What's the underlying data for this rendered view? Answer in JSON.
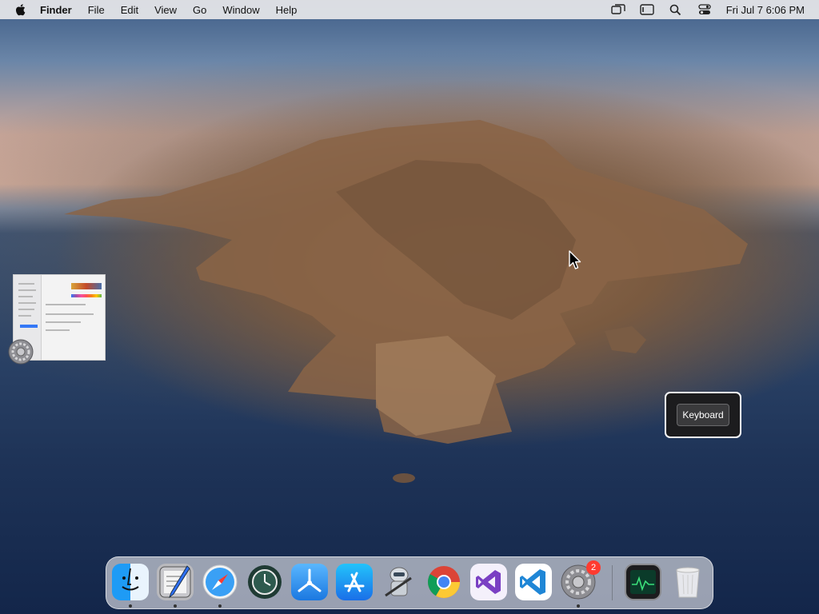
{
  "menubar": {
    "apple_icon": "apple-logo-icon",
    "app_name": "Finder",
    "menus": [
      "File",
      "Edit",
      "View",
      "Go",
      "Window",
      "Help"
    ],
    "status_icons": [
      "screen-mirroring-icon",
      "display-icon",
      "spotlight-search-icon",
      "control-center-icon"
    ],
    "clock": "Fri Jul 7  6:06 PM"
  },
  "desktop": {
    "wallpaper": "macOS Catalina island wallpaper",
    "window_thumbnail": {
      "app_icon": "system-preferences-icon"
    },
    "popup": {
      "button_label": "Keyboard"
    }
  },
  "dock": {
    "apps": [
      {
        "name": "Finder",
        "icon": "finder-icon",
        "running": true
      },
      {
        "name": "Script Editor",
        "icon": "script-editor-icon",
        "running": true
      },
      {
        "name": "Safari",
        "icon": "safari-icon",
        "running": true
      },
      {
        "name": "Time Machine",
        "icon": "time-machine-icon",
        "running": false
      },
      {
        "name": "Instruments",
        "icon": "instruments-icon",
        "running": false
      },
      {
        "name": "App Store",
        "icon": "app-store-icon",
        "running": false
      },
      {
        "name": "Automator",
        "icon": "automator-icon",
        "running": false
      },
      {
        "name": "Google Chrome",
        "icon": "chrome-icon",
        "running": false
      },
      {
        "name": "Visual Studio",
        "icon": "visual-studio-icon",
        "running": false
      },
      {
        "name": "Visual Studio Code",
        "icon": "vscode-icon",
        "running": false
      },
      {
        "name": "System Preferences",
        "icon": "system-preferences-icon",
        "running": true,
        "badge": "2"
      },
      {
        "name": "Activity Monitor",
        "icon": "activity-monitor-icon",
        "running": false
      },
      {
        "name": "Trash",
        "icon": "trash-icon",
        "running": false
      }
    ]
  },
  "colors": {
    "badge": "#ff3b30",
    "popup_bg": "#1c1c1e",
    "accent": "#3478f6"
  }
}
